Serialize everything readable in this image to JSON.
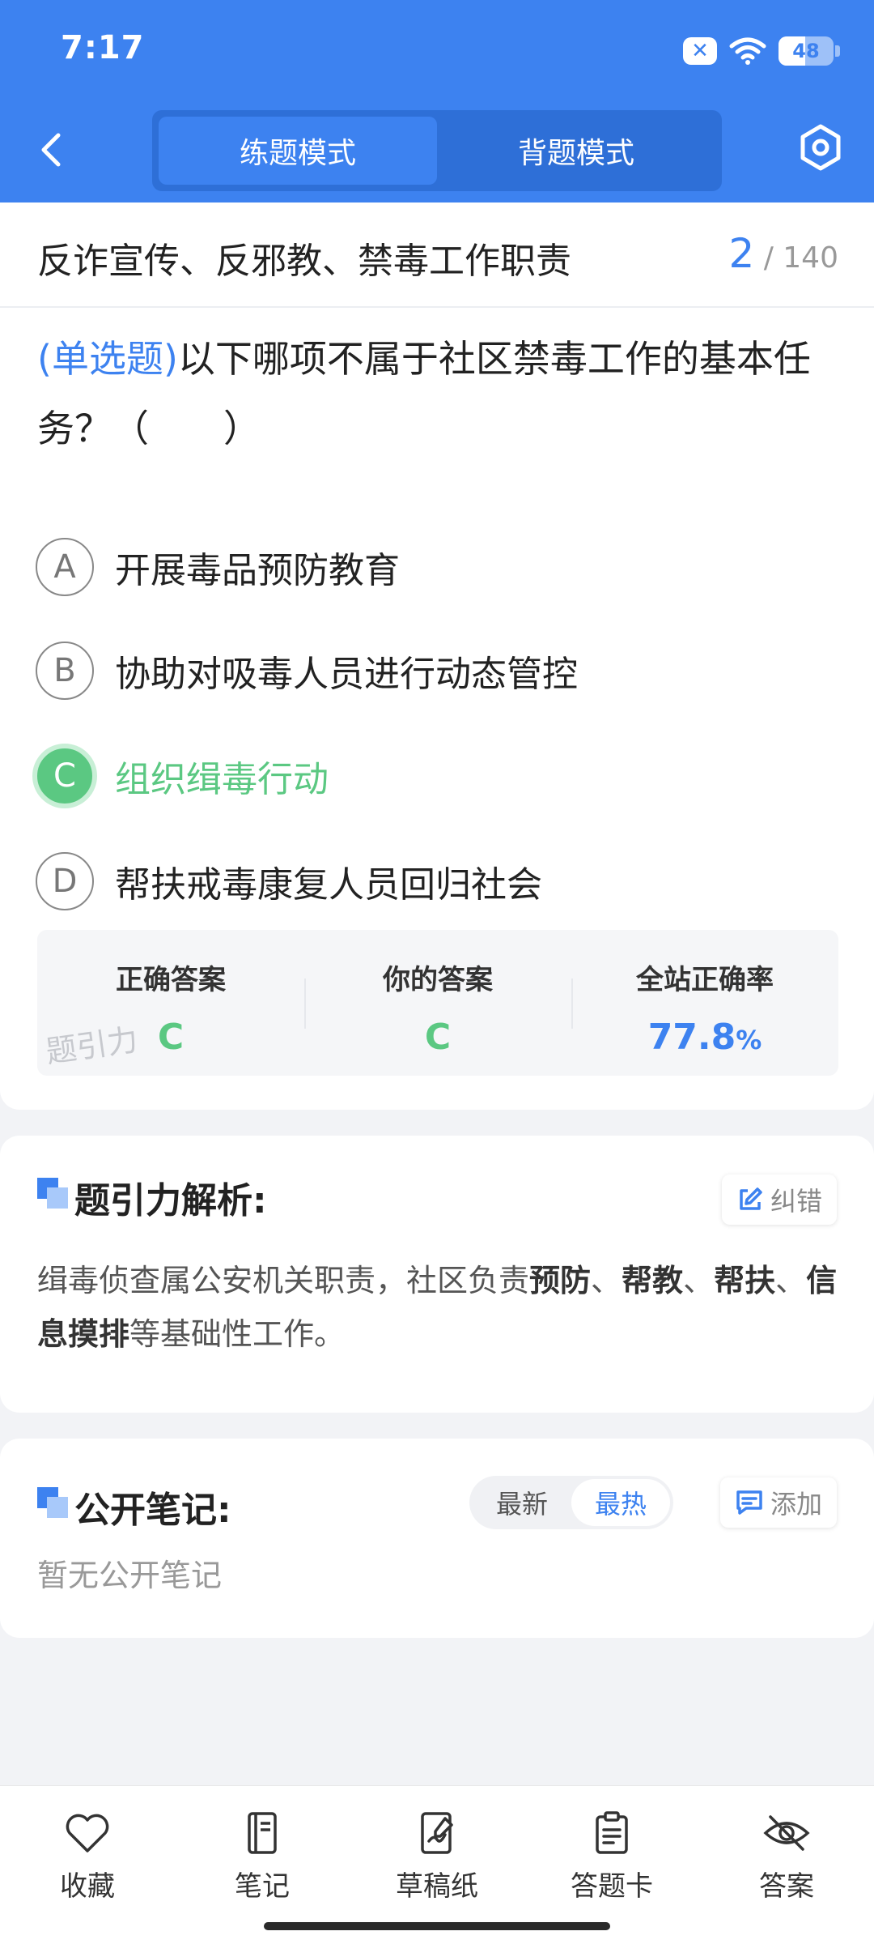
{
  "status_bar": {
    "time": "7:17",
    "battery": "48",
    "battery_level": 0.48
  },
  "header": {
    "tabs": [
      {
        "label": "练题模式",
        "active": true
      },
      {
        "label": "背题模式",
        "active": false
      }
    ]
  },
  "topic": {
    "title": "反诈宣传、反邪教、禁毒工作职责",
    "current": "2",
    "total": "/ 140"
  },
  "question": {
    "type": "(单选题)",
    "text": "以下哪项不属于社区禁毒工作的基本任务？（　　）",
    "options": [
      {
        "letter": "A",
        "text": "开展毒品预防教育"
      },
      {
        "letter": "B",
        "text": "协助对吸毒人员进行动态管控"
      },
      {
        "letter": "C",
        "text": "组织缉毒行动",
        "selected_correct": true
      },
      {
        "letter": "D",
        "text": "帮扶戒毒康复人员回归社会"
      }
    ]
  },
  "stats": {
    "correct_label": "正确答案",
    "correct_value": "C",
    "yours_label": "你的答案",
    "yours_value": "C",
    "rate_label": "全站正确率",
    "rate_value": "77.8",
    "rate_unit": "%",
    "watermark": "题引力"
  },
  "analysis": {
    "title": "题引力解析:",
    "report_label": "纠错",
    "text_parts": [
      "缉毒侦查属公安机关职责，社区负责",
      "预防",
      "、",
      "帮教",
      "、",
      "帮扶",
      "、",
      "信息摸排",
      "等基础性工作。"
    ]
  },
  "notes": {
    "title": "公开笔记:",
    "sort_latest": "最新",
    "sort_hot": "最热",
    "add_label": "添加",
    "empty": "暂无公开笔记"
  },
  "bottom_nav": [
    {
      "label": "收藏",
      "icon": "heart-icon"
    },
    {
      "label": "笔记",
      "icon": "notebook-icon"
    },
    {
      "label": "草稿纸",
      "icon": "draft-icon"
    },
    {
      "label": "答题卡",
      "icon": "answer-card-icon"
    },
    {
      "label": "答案",
      "icon": "eye-off-icon"
    }
  ],
  "colors": {
    "primary": "#3d82f0",
    "correct": "#5bc882"
  }
}
